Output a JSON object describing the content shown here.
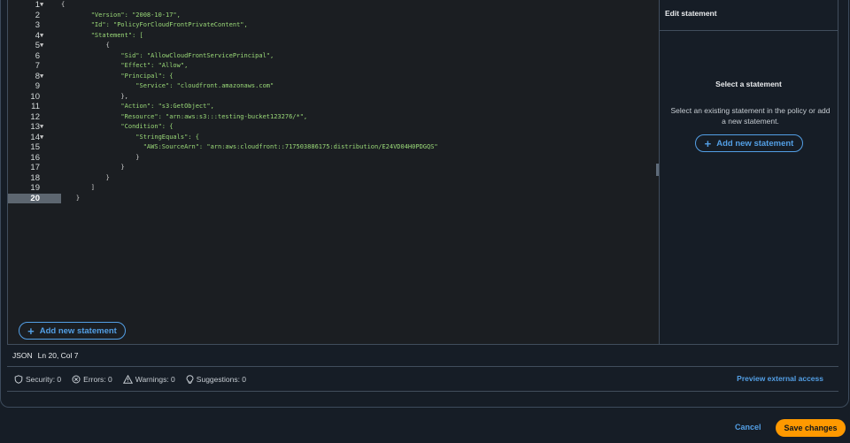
{
  "editor": {
    "lines": [
      {
        "n": "1",
        "fold": true,
        "code": "{"
      },
      {
        "n": "2",
        "fold": false,
        "code": "        \"Version\": \"2008-10-17\","
      },
      {
        "n": "3",
        "fold": false,
        "code": "        \"Id\": \"PolicyForCloudFrontPrivateContent\","
      },
      {
        "n": "4",
        "fold": true,
        "code": "        \"Statement\": ["
      },
      {
        "n": "5",
        "fold": true,
        "code": "            {"
      },
      {
        "n": "6",
        "fold": false,
        "code": "                \"Sid\": \"AllowCloudFrontServicePrincipal\","
      },
      {
        "n": "7",
        "fold": false,
        "code": "                \"Effect\": \"Allow\","
      },
      {
        "n": "8",
        "fold": true,
        "code": "                \"Principal\": {"
      },
      {
        "n": "9",
        "fold": false,
        "code": "                    \"Service\": \"cloudfront.amazonaws.com\""
      },
      {
        "n": "10",
        "fold": false,
        "code": "                },"
      },
      {
        "n": "11",
        "fold": false,
        "code": "                \"Action\": \"s3:GetObject\","
      },
      {
        "n": "12",
        "fold": false,
        "code": "                \"Resource\": \"arn:aws:s3:::testing-bucket123276/*\","
      },
      {
        "n": "13",
        "fold": true,
        "code": "                \"Condition\": {"
      },
      {
        "n": "14",
        "fold": true,
        "code": "                    \"StringEquals\": {"
      },
      {
        "n": "15",
        "fold": false,
        "code": "                      \"AWS:SourceArn\": \"arn:aws:cloudfront::717503886175:distribution/E24VD04H0PDGQS\""
      },
      {
        "n": "16",
        "fold": false,
        "code": "                    }"
      },
      {
        "n": "17",
        "fold": false,
        "code": "                }"
      },
      {
        "n": "18",
        "fold": false,
        "code": "            }"
      },
      {
        "n": "19",
        "fold": false,
        "code": "        ]"
      },
      {
        "n": "20",
        "fold": false,
        "code": "    }"
      }
    ],
    "active_line": "20",
    "fold_glyph": "▼",
    "add_statement_label": "Add new statement",
    "plus_glyph": "+"
  },
  "side_panel": {
    "heading": "Edit statement",
    "title": "Select a statement",
    "description": "Select an existing statement in the policy or add a new statement.",
    "add_statement_label": "Add new statement",
    "plus_glyph": "+"
  },
  "status": {
    "language": "JSON",
    "position": "Ln 20, Col 7"
  },
  "issues": {
    "security": "Security: 0",
    "errors": "Errors: 0",
    "warnings": "Warnings: 0",
    "suggestions": "Suggestions: 0",
    "preview_label": "Preview external access"
  },
  "footer": {
    "cancel_label": "Cancel",
    "save_label": "Save changes"
  },
  "colors": {
    "accent": "#539fe5",
    "primary_button": "#ff9900",
    "string": "#9ad978"
  }
}
